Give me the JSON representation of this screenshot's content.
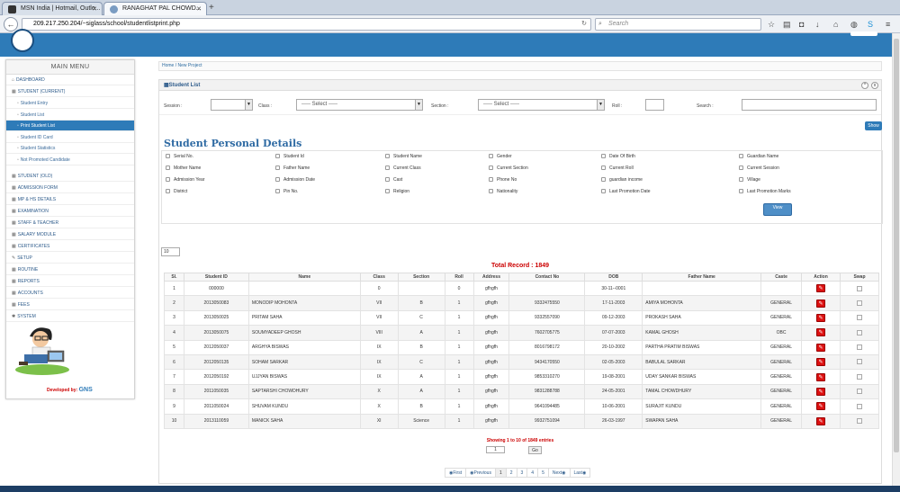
{
  "browser": {
    "tabs": [
      {
        "label": "MSN India | Hotmail, Outlo..."
      },
      {
        "label": "RANAGHAT PAL CHOWD..."
      }
    ],
    "url_host": "209.217.250.204",
    "url_path": "/~siglass/school/studentlistprint.php",
    "search_placeholder": "Search"
  },
  "sidebar": {
    "title": "MAIN MENU",
    "items": [
      {
        "label": "DASHBOARD"
      },
      {
        "label": "STUDENT (CURRENT)"
      },
      {
        "label": "Student Entry"
      },
      {
        "label": "Student List"
      },
      {
        "label": "Print Student List"
      },
      {
        "label": "Student ID Card"
      },
      {
        "label": "Student Statistics"
      },
      {
        "label": "Not Promoted Candidate"
      },
      {
        "label": "STUDENT (OLD)"
      },
      {
        "label": "ADMISSION FORM"
      },
      {
        "label": "MP & HS Details"
      },
      {
        "label": "EXAMINATION"
      },
      {
        "label": "STAFF & TEACHER"
      },
      {
        "label": "SALARY MODULE"
      },
      {
        "label": "CERTIFICATES"
      },
      {
        "label": "SETUP"
      },
      {
        "label": "ROUTINE"
      },
      {
        "label": "REPORTS"
      },
      {
        "label": "ACCOUNTS"
      },
      {
        "label": "FEES"
      },
      {
        "label": "SYSTEM"
      }
    ],
    "developed_by": "Developed by:",
    "brand": "GNS"
  },
  "breadcrumb": {
    "home": "Home",
    "sep": "/",
    "current": "New Project"
  },
  "panel": {
    "title": "Student List",
    "filters": {
      "session_label": "Session :",
      "class_label": "Class :",
      "class_value": "----- Select -----",
      "section_label": "Section :",
      "section_value": "----- Select -----",
      "roll_label": "Roll :",
      "search_label": "Search :"
    },
    "show_button": "Show",
    "details_title": "Student Personal Details",
    "fields": [
      [
        "Serial No.",
        "Student Id",
        "Student Name",
        "Gender",
        "Date Of Birth",
        "Guardian Name"
      ],
      [
        "Mother Name",
        "Father Name",
        "Current Class",
        "Current Section",
        "Current Roll",
        "Current Session"
      ],
      [
        "Admission Year",
        "Admission Date",
        "Cast",
        "Phone No",
        "guardian income",
        "Village"
      ],
      [
        "District",
        "Pin No.",
        "Religion",
        "Nationality",
        "Last Promotion Date",
        "Last Promotion Marks"
      ]
    ],
    "view_button": "View",
    "page_length": "10",
    "total_record": "Total Record : 1849",
    "table_headers": [
      "Sl.",
      "Student ID",
      "Name",
      "Class",
      "Section",
      "Roll",
      "Address",
      "Contact No",
      "DOB",
      "Father Name",
      "Caste",
      "Action",
      "Swap"
    ],
    "rows": [
      [
        "1",
        "000000",
        "",
        "0",
        "",
        "0",
        "gfhgfh",
        "",
        "30-11--0001",
        "",
        ""
      ],
      [
        "2",
        "2013050083",
        "MONODIP MOHONTA",
        "VII",
        "B",
        "1",
        "gfhgfh",
        "9332475550",
        "17-11-2003",
        "AMIYA MOHONTA",
        "GENERAL"
      ],
      [
        "3",
        "2013050025",
        "PRITAM SAHA",
        "VII",
        "C",
        "1",
        "gfhgfh",
        "9332557090",
        "09-12-2003",
        "PROKASH SAHA",
        "GENERAL"
      ],
      [
        "4",
        "2013050075",
        "SOUMYADEEP GHOSH",
        "VIII",
        "A",
        "1",
        "gfhgfh",
        "7602705775",
        "07-07-2003",
        "KAMAL GHOSH",
        "OBC"
      ],
      [
        "5",
        "2012050037",
        "ARGHYA BISWAS",
        "IX",
        "B",
        "1",
        "gfhgfh",
        "8016798172",
        "20-10-2002",
        "PARTHA PRATIM BISWAS",
        "GENERAL"
      ],
      [
        "6",
        "2012050135",
        "SOHAM SARKAR",
        "IX",
        "C",
        "1",
        "gfhgfh",
        "9434170550",
        "02-05-2003",
        "BABULAL SARKAR",
        "GENERAL"
      ],
      [
        "7",
        "2012050192",
        "UJJYAN BISWAS",
        "IX",
        "A",
        "1",
        "gfhgfh",
        "9853310270",
        "19-08-2001",
        "UDAY SANKAR BISWAS",
        "GENERAL"
      ],
      [
        "8",
        "2011050035",
        "SAPTARSHI CHOWDHURY",
        "X",
        "A",
        "1",
        "gfhgfh",
        "9831288788",
        "24-05-2001",
        "TAMAL CHOWDHURY",
        "GENERAL"
      ],
      [
        "9",
        "2011050024",
        "SHUVAM KUNDU",
        "X",
        "B",
        "1",
        "gfhgfh",
        "9641094485",
        "10-06-2001",
        "SURAJIT KUNDU",
        "GENERAL"
      ],
      [
        "10",
        "2013110059",
        "MANICK SAHA",
        "XI",
        "Science",
        "1",
        "gfhgfh",
        "9932751094",
        "26-03-1997",
        "SWAPAN SAHA",
        "GENERAL"
      ]
    ],
    "showing": "Showing 1 to 10 of 1849 entries",
    "page_input": "1",
    "go_button": "Go",
    "pager": {
      "first": "First",
      "previous": "Previous",
      "pages": [
        "1",
        "2",
        "3",
        "4",
        "5"
      ],
      "next": "Next",
      "last": "Last"
    }
  },
  "colors": {
    "header_blue": "#2e7bb8",
    "total_red": "#cc0000",
    "action_red": "#dd1111"
  }
}
